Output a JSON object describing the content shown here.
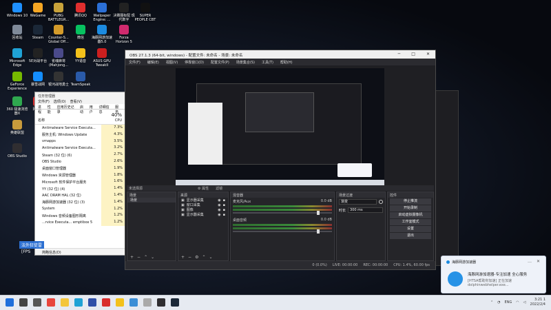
{
  "desktop_icons": [
    {
      "label": "Windows 10",
      "color": "#1e90ff"
    },
    {
      "label": "WeGame",
      "color": "#f5a623"
    },
    {
      "label": "PUBG BATTLEGR...",
      "color": "#c8a23a"
    },
    {
      "label": "腾讯QQ",
      "color": "#e02e2e"
    },
    {
      "label": "Wallpaper Engine: ...",
      "color": "#2b6fd6"
    },
    {
      "label": "决赛圈标配 现代数字",
      "color": "#222222"
    },
    {
      "label": "SUPER PEOPLE CBT",
      "color": "#111111"
    },
    {
      "label": "回收站",
      "color": "#7f8a99"
    },
    {
      "label": "Steam",
      "color": "#1b2838"
    },
    {
      "label": "Counter-S... Global Off...",
      "color": "#d49b2a"
    },
    {
      "label": "微信",
      "color": "#07c160"
    },
    {
      "label": "海豚网游加速器5.0",
      "color": "#1c8be0"
    },
    {
      "label": "Forza Horizon 5",
      "color": "#d02a6e"
    },
    {
      "label": "Microsoft Edge",
      "color": "#1fa2d5"
    },
    {
      "label": "5E对战平台",
      "color": "#222222"
    },
    {
      "label": "雀魂麻将 (Mahjong...",
      "color": "#4a4a8a"
    },
    {
      "label": "YY语音",
      "color": "#f3c11b"
    },
    {
      "label": "ASUS GPU TweakII",
      "color": "#cc1f1f"
    },
    {
      "label": "GeForce Experience",
      "color": "#76b900"
    },
    {
      "label": "暴雪战网",
      "color": "#148eff"
    },
    {
      "label": "银河战地勇士",
      "color": "#333333"
    },
    {
      "label": "TeamSpeak",
      "color": "#2a5aa8"
    },
    {
      "label": "360 极速浏览器X",
      "color": "#2fa84f"
    },
    {
      "label": "网易云",
      "color": "#d92d2d"
    },
    {
      "label": "英雄联盟",
      "color": "#c89b3c"
    },
    {
      "label": "OBS Studio",
      "color": "#302e31"
    }
  ],
  "taskmgr": {
    "title": "任务管理器",
    "menu": [
      "文件(F)",
      "选项(O)",
      "查看(V)"
    ],
    "tabs": [
      "进程",
      "性能",
      "应用历史记录",
      "启动",
      "用户",
      "详细信息",
      "服务"
    ],
    "name_header": "名称",
    "cpu_pct": "40%",
    "cpu_label": "CPU",
    "rows": [
      {
        "name": "Antimalware Service Executa...",
        "cpu": "7.3%"
      },
      {
        "name": "服务主机: Windows Update",
        "cpu": "4.3%"
      },
      {
        "name": "vmapps",
        "cpu": "3.5%"
      },
      {
        "name": "Antimalware Service Executa...",
        "cpu": "3.2%"
      },
      {
        "name": "Steam (32 位) (6)",
        "cpu": "2.7%"
      },
      {
        "name": "OBS Studio",
        "cpu": "2.6%"
      },
      {
        "name": "桌面窗口管理器",
        "cpu": "1.9%"
      },
      {
        "name": "Windows 资源管理器",
        "cpu": "1.8%"
      },
      {
        "name": "Microsoft 软件保护平台服务",
        "cpu": "1.6%"
      },
      {
        "name": "YY (32 位) (4)",
        "cpu": "1.4%"
      },
      {
        "name": "AAC DRAM HAL (32 位)",
        "cpu": "1.4%"
      },
      {
        "name": "海豚网游加速器 (32 位) (3)",
        "cpu": "1.4%"
      },
      {
        "name": "System",
        "cpu": "1.2%"
      },
      {
        "name": "Windows 音频设备图形隔离",
        "cpu": "1.2%"
      },
      {
        "name": "...rvice Executa... emptibox 5",
        "cpu": "1.2%"
      }
    ],
    "footer": "简略信息(D)"
  },
  "obs": {
    "title": "OBS 27.1.3 (64-bit, windows) - 配置文件: 未命名 - 场景: 未命名",
    "menu": [
      "文件(F)",
      "编辑(E)",
      "视图(V)",
      "停靠窗口(D)",
      "配置文件(P)",
      "场景集合(S)",
      "工具(T)",
      "帮助(H)"
    ],
    "no_source": "未选择源",
    "props_btn": "⚙ 属性",
    "filters_btn": "滤镜",
    "docks": {
      "scenes": {
        "title": "场景",
        "items": [
          "场景"
        ]
      },
      "sources": {
        "title": "来源",
        "items": [
          "显示器采集",
          "窗口采集",
          "图像",
          "显示器采集"
        ]
      },
      "mixer": {
        "title": "混音器",
        "channels": [
          {
            "name": "麦克风/Aux",
            "db": "0.0 dB"
          },
          {
            "name": "桌面音频",
            "db": "0.0 dB"
          }
        ]
      },
      "transitions": {
        "title": "场景过渡",
        "type": "渐变",
        "duration_label": "时长",
        "duration": "300 ms"
      },
      "controls": {
        "title": "控件",
        "buttons": [
          "停止推流",
          "开始录制",
          "启动虚拟摄像机",
          "工作室模式",
          "设置",
          "退出"
        ]
      }
    },
    "status": {
      "dropped": "0 (0.0%)",
      "live": "LIVE: 00:00:00",
      "rec": "REC: 00:00:00",
      "cpu": "CPU: 1.4%, 60.00 fps"
    }
  },
  "toast": {
    "app": "海豚网游加速器",
    "message": "海豚网游加速器-专注加速 全心服务",
    "sub": "[HTSA帮助你加速] 正在加速",
    "sub2": "dolphinwebhelper.exe..."
  },
  "overlay": {
    "line1": "法外狂徒雷",
    "line2": "[FPS"
  },
  "taskbar": {
    "icons": [
      {
        "name": "windows",
        "color": "#1f6fdb"
      },
      {
        "name": "search",
        "color": "#444444"
      },
      {
        "name": "task-view",
        "color": "#555555"
      },
      {
        "name": "chrome",
        "color": "#e8453c"
      },
      {
        "name": "file-explorer",
        "color": "#f4c63b"
      },
      {
        "name": "edge",
        "color": "#1fa2d5"
      },
      {
        "name": "store",
        "color": "#2f4fa8"
      },
      {
        "name": "netease",
        "color": "#d92d2d"
      },
      {
        "name": "yy",
        "color": "#f3c11b"
      },
      {
        "name": "task-manager",
        "color": "#3b8ed6"
      },
      {
        "name": "app",
        "color": "#aaaaaa"
      },
      {
        "name": "obs",
        "color": "#302e31"
      },
      {
        "name": "steam",
        "color": "#1b2838"
      }
    ],
    "lang": "ENG",
    "time": "3:21 1",
    "date": "2022/2/4"
  }
}
